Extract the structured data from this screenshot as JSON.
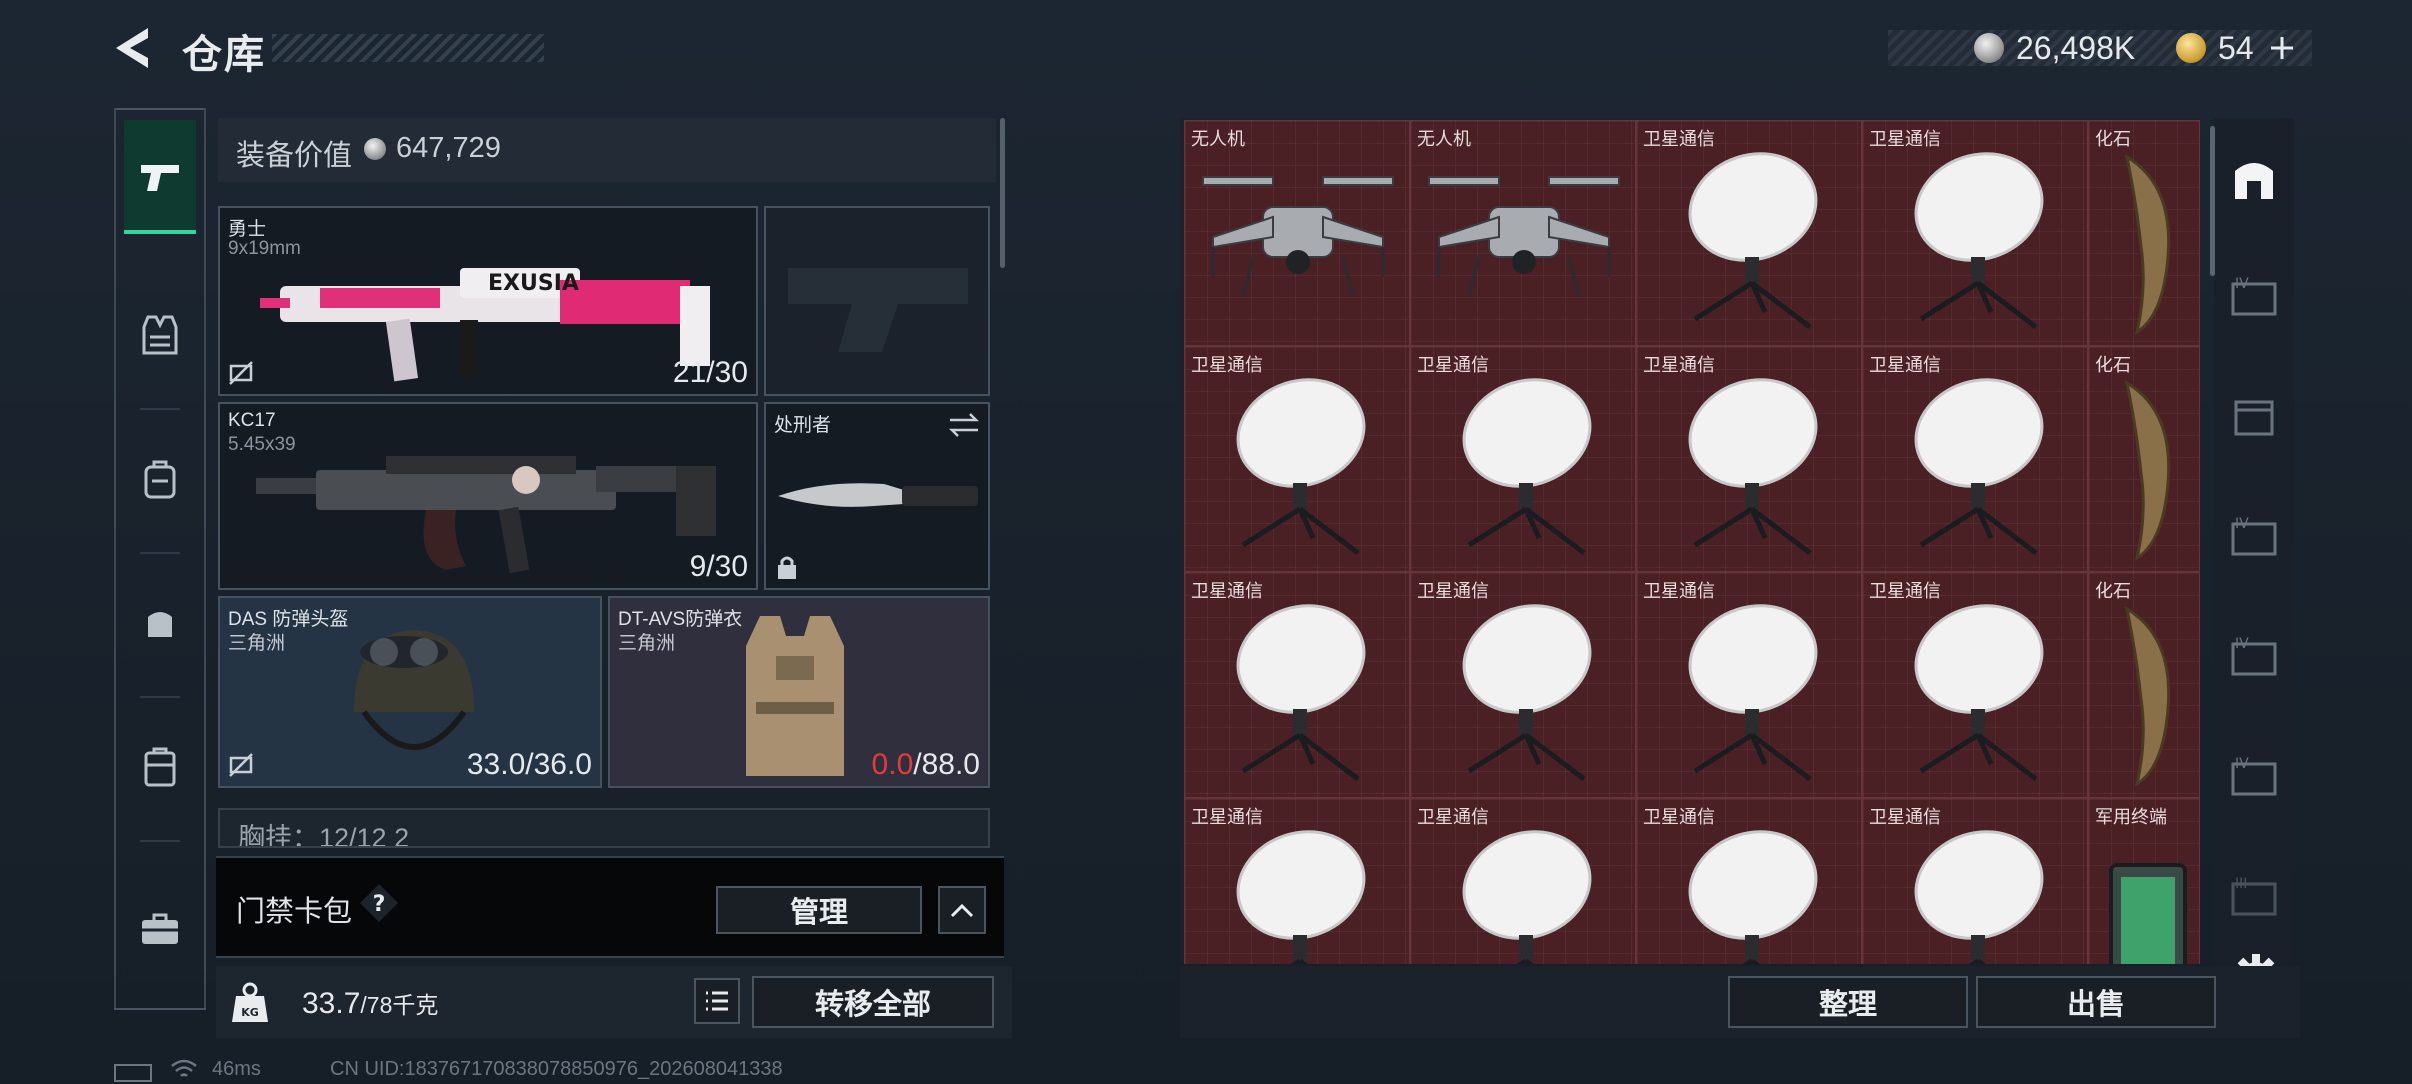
{
  "header": {
    "title": "仓库",
    "currency_silver": "26,498K",
    "currency_gold": "54"
  },
  "left_rail": [
    "firearm-icon",
    "vest-icon",
    "backpack-icon",
    "pouch-icon",
    "container-icon",
    "case-icon"
  ],
  "equipment": {
    "value_label": "装备价值",
    "value": "647,729",
    "primary": {
      "name": "勇士",
      "caliber": "9x19mm",
      "ammo": "21/30"
    },
    "secondary": {
      "name": "KC17",
      "caliber": "5.45x39",
      "ammo": "9/30"
    },
    "melee": {
      "name": "处刑者"
    },
    "helmet": {
      "name": "DAS 防弹头盔",
      "origin": "三角洲",
      "durability": "33.0",
      "max": "/36.0"
    },
    "armor": {
      "name": "DT-AVS防弹衣",
      "origin": "三角洲",
      "durability": "0.0",
      "max": "/88.0"
    },
    "chest_partial": "胸挂：12/12  2"
  },
  "keycard": {
    "label": "门禁卡包",
    "help": "?",
    "manage_button": "管理"
  },
  "weight": {
    "value": "33.7",
    "limit": "/78千克",
    "transfer_button": "转移全部"
  },
  "status": {
    "ping": "46ms",
    "uid": "CN UID:183767170838078850976_202608041338"
  },
  "grid_items": [
    [
      "无人机",
      "无人机",
      "卫星通信",
      "卫星通信",
      "化石"
    ],
    [
      "卫星通信",
      "卫星通信",
      "卫星通信",
      "卫星通信",
      "化石"
    ],
    [
      "卫星通信",
      "卫星通信",
      "卫星通信",
      "卫星通信",
      "化石"
    ],
    [
      "卫星通信",
      "卫星通信",
      "卫星通信",
      "卫星通信",
      "军用终端"
    ]
  ],
  "grid_item_types": [
    [
      "drone",
      "drone",
      "dish",
      "dish",
      "fossil"
    ],
    [
      "dish",
      "dish",
      "dish",
      "dish",
      "fossil"
    ],
    [
      "dish",
      "dish",
      "dish",
      "dish",
      "fossil"
    ],
    [
      "dish",
      "dish",
      "dish",
      "dish",
      "terminal"
    ]
  ],
  "actions": {
    "sort_button": "整理",
    "sell_button": "出售"
  },
  "colors": {
    "accent": "#37d39b",
    "cell_bg": "#4a2024",
    "durability_zero": "#e43a3a"
  }
}
